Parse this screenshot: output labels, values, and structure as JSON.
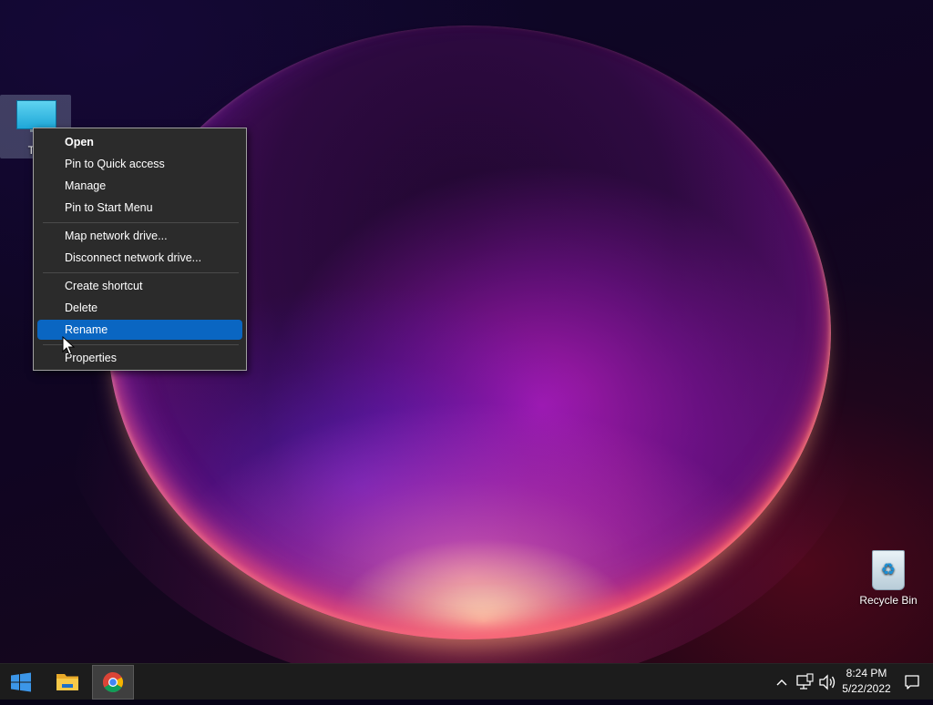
{
  "desktop": {
    "icons": [
      {
        "label": "Thi",
        "icon": "this-pc-icon"
      },
      {
        "label": "Recycle Bin",
        "icon": "recycle-bin-icon"
      }
    ]
  },
  "context_menu": {
    "items": [
      {
        "label": "Open",
        "bold": true
      },
      {
        "label": "Pin to Quick access"
      },
      {
        "label": "Manage"
      },
      {
        "label": "Pin to Start Menu"
      },
      {
        "label": "Map network drive..."
      },
      {
        "label": "Disconnect network drive..."
      },
      {
        "label": "Create shortcut"
      },
      {
        "label": "Delete"
      },
      {
        "label": "Rename",
        "highlighted": true
      },
      {
        "label": "Properties"
      }
    ]
  },
  "taskbar": {
    "apps": [
      {
        "icon": "windows-start-icon"
      },
      {
        "icon": "file-explorer-icon"
      },
      {
        "icon": "chrome-icon",
        "active": true
      }
    ],
    "tray_icons": [
      "chevron-up-icon",
      "network-icon",
      "volume-icon"
    ],
    "clock": {
      "time": "8:24 PM",
      "date": "5/22/2022"
    },
    "notification_icon": "notification-icon"
  },
  "colors": {
    "menu_bg": "#2b2b2b",
    "menu_highlight": "#0a66c2",
    "taskbar_bg": "#1c1c1c"
  }
}
